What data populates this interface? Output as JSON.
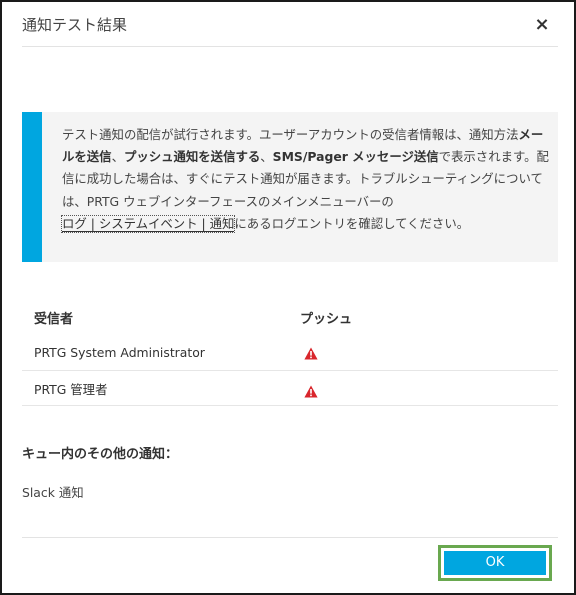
{
  "dialog": {
    "title": "通知テスト結果",
    "close_label": "×"
  },
  "info": {
    "seg1": "テスト通知の配信が試行されます。ユーザーアカウントの受信者情報は、通知方法",
    "seg2_bold": "メールを送信",
    "seg3": "、",
    "seg4_bold": "プッシュ通知を送信する",
    "seg5": "、",
    "seg6_bold": "SMS/Pager メッセージ送信",
    "seg7": "で表示されます。配信に成功した場合は、すぐにテスト通知が届きます。トラブルシューティングについては、PRTG ウェブインターフェースのメインメニューバーの",
    "link": "ログ | システムイベント | 通知",
    "seg8": "にあるログエントリを確認してください。"
  },
  "table": {
    "headers": {
      "recipient": "受信者",
      "push": "プッシュ"
    },
    "rows": [
      {
        "name": "PRTG System Administrator",
        "status_icon": "warning-icon"
      },
      {
        "name": "PRTG 管理者",
        "status_icon": "warning-icon"
      }
    ]
  },
  "queue": {
    "title": "キュー内のその他の通知：",
    "items": [
      "Slack 通知"
    ]
  },
  "footer": {
    "ok_label": "OK"
  },
  "colors": {
    "accent": "#00a6e0",
    "warning": "#d9262c",
    "highlight_frame": "#69a84f"
  }
}
